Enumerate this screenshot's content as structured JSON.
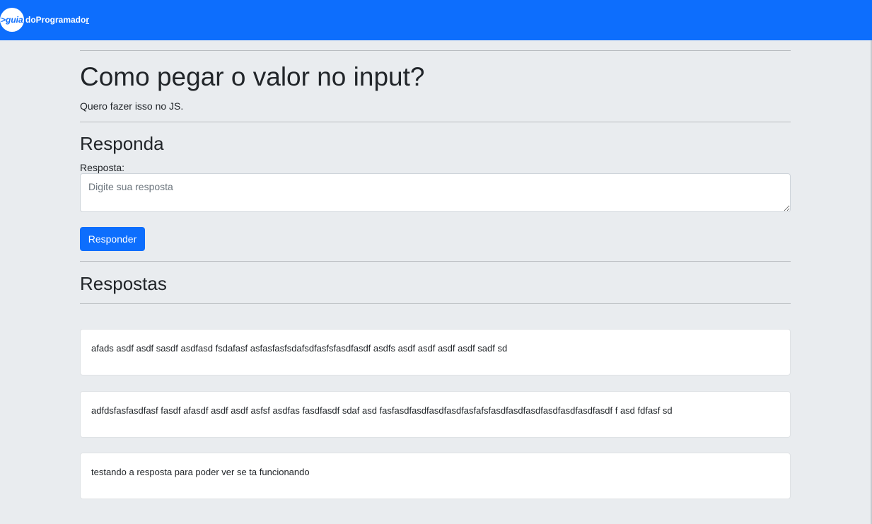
{
  "navbar": {
    "logo_circle_text": ">guia",
    "logo_text": "doProgramado",
    "logo_cursor": "r"
  },
  "question": {
    "title": "Como pegar o valor no input?",
    "description": "Quero fazer isso no JS."
  },
  "answer_form": {
    "heading": "Responda",
    "label": "Resposta:",
    "placeholder": "Digite sua resposta",
    "submit_label": "Responder"
  },
  "answers": {
    "heading": "Respostas",
    "items": [
      {
        "text": "afads asdf asdf sasdf asdfasd fsdafasf asfasfasfsdafsdfasfsfasdfasdf asdfs asdf asdf asdf asdf sadf sd"
      },
      {
        "text": "adfdsfasfasdfasf fasdf afasdf asdf asdf asfsf asdfas fasdfasdf sdaf asd fasfasdfasdfasdfasdfasfafsfasdfasdfasdfasdfasdfasdfasdf f asd fdfasf sd"
      },
      {
        "text": "testando a resposta para poder ver se ta funcionando"
      }
    ]
  },
  "colors": {
    "primary": "#0d6efd",
    "page_background": "#e9ecef",
    "card_background": "#ffffff"
  }
}
